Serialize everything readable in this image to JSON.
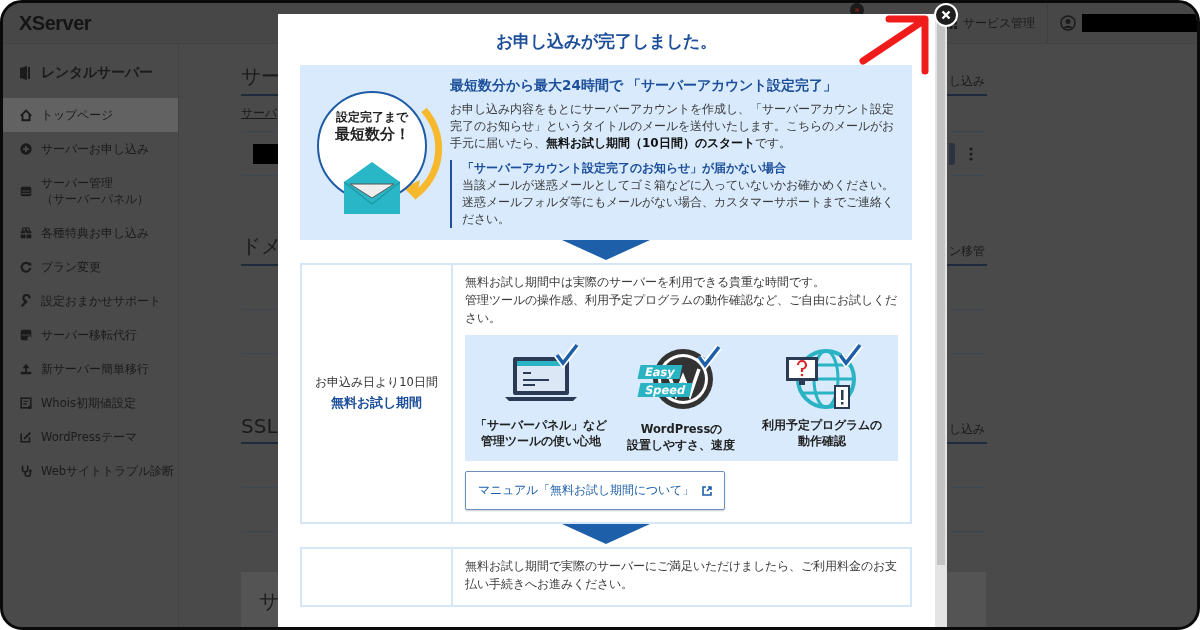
{
  "header": {
    "logo": "XServer",
    "service_menu": "サービス管理"
  },
  "sidebar": {
    "title": "レンタルサーバー",
    "items": [
      {
        "label": "トップページ",
        "selected": true
      },
      {
        "label": "サーバーお申し込み",
        "selected": false
      },
      {
        "label": "サーバー管理",
        "sublabel": "（サーバーパネル）",
        "selected": false
      },
      {
        "label": "各種特典お申し込み",
        "selected": false
      },
      {
        "label": "プラン変更",
        "selected": false
      },
      {
        "label": "設定おまかせサポート",
        "selected": false
      },
      {
        "label": "サーバー移転代行",
        "selected": false
      },
      {
        "label": "新サーバー簡単移行",
        "selected": false
      },
      {
        "label": "Whois初期値設定",
        "selected": false
      },
      {
        "label": "WordPressテーマ",
        "selected": false
      },
      {
        "label": "Webサイトトラブル診断",
        "selected": false
      }
    ]
  },
  "background_page": {
    "sections": [
      {
        "heading": "サー",
        "action": "し込み"
      },
      {
        "heading": "ドメ",
        "action": "ン移管"
      },
      {
        "heading": "SSL",
        "action": "し込み"
      }
    ],
    "table_header": "サーバ",
    "card_heading": "サ"
  },
  "modal": {
    "title": "お申し込みが完了しました。",
    "intro": {
      "badge_small": "設定完了まで",
      "badge_large": "最短数分！",
      "heading": "最短数分から最大24時間で 「サーバーアカウント設定完了」",
      "body": "お申し込み内容をもとにサーバーアカウントを作成し、「サーバーアカウント設定完了のお知らせ」というタイトルのメールを送付いたします。こちらのメールがお手元に届いたら、**無料お試し期間（10日間）のスタート**です。",
      "note_heading": "「サーバーアカウント設定完了のお知らせ」が届かない場合",
      "note_body": "当該メールが迷惑メールとしてゴミ箱などに入っていないかお確かめください。迷惑メールフォルダ等にもメールがない場合、カスタマーサポートまでご連絡ください。"
    },
    "steps": [
      {
        "side_note": "お申込み日より10日間",
        "side_title": "無料お試し期間",
        "paragraphs": [
          "無料お試し期間中は実際のサーバーを利用できる貴重な時間です。",
          "管理ツールの操作感、利用予定プログラムの動作確認など、ご自由にお試しください。"
        ],
        "features": [
          {
            "kind": "panel",
            "lines": [
              "「サーバーパネル」など",
              "管理ツールの使い心地"
            ]
          },
          {
            "kind": "wordpress",
            "tags": [
              "Easy",
              "Speed"
            ],
            "lines": [
              "WordPressの",
              "設置しやすさ、速度"
            ]
          },
          {
            "kind": "program",
            "lines": [
              "利用予定プログラムの",
              "動作確認"
            ]
          }
        ],
        "manual_button": "マニュアル「無料お試し期間について」"
      },
      {
        "paragraphs": [
          "無料お試し期間で実際のサーバーにご満足いただけましたら、ご利用料金のお支払い手続きへお進みください。"
        ]
      }
    ]
  }
}
